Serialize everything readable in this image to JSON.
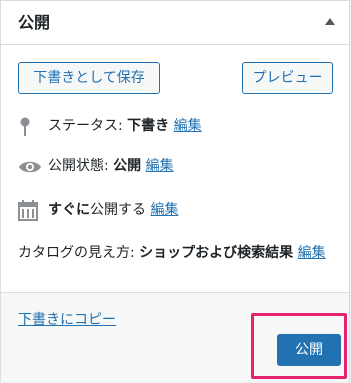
{
  "panel": {
    "title": "公開",
    "save_draft_label": "下書きとして保存",
    "preview_label": "プレビュー"
  },
  "status": {
    "label": "ステータス:",
    "value": "下書き",
    "edit": "編集",
    "icon": "pin-icon"
  },
  "visibility": {
    "label": "公開状態:",
    "value": "公開",
    "edit": "編集",
    "icon": "eye-icon"
  },
  "schedule": {
    "label": "すぐに",
    "label2": "公開する",
    "edit": "編集",
    "icon": "calendar-icon"
  },
  "catalog": {
    "label": "カタログの見え方:",
    "value": "ショップおよび検索結果",
    "edit": "編集"
  },
  "actions": {
    "copy_draft": "下書きにコピー",
    "publish_label": "公開"
  },
  "colors": {
    "accent": "#2271b1",
    "highlight": "#e8216e",
    "icon": "#8c8f94"
  }
}
